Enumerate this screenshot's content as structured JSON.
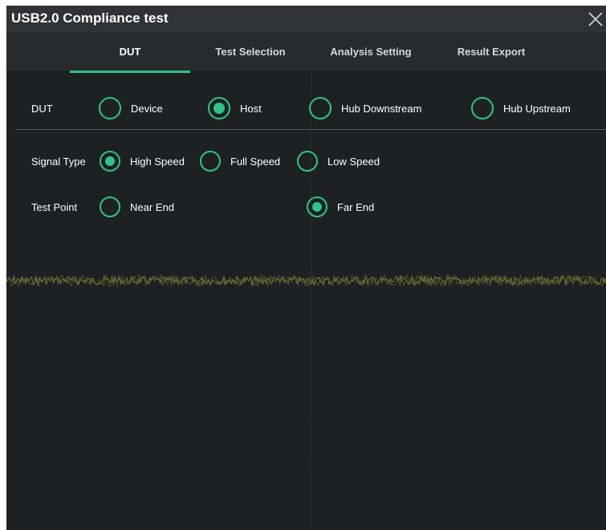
{
  "window": {
    "title": "USB2.0 Compliance test"
  },
  "tabs": [
    {
      "label": "DUT",
      "active": true
    },
    {
      "label": "Test Selection",
      "active": false
    },
    {
      "label": "Analysis Setting",
      "active": false
    },
    {
      "label": "Result Export",
      "active": false
    }
  ],
  "dut": {
    "label": "DUT",
    "options": [
      {
        "label": "Device",
        "selected": false
      },
      {
        "label": "Host",
        "selected": true
      },
      {
        "label": "Hub Downstream",
        "selected": false
      },
      {
        "label": "Hub Upstream",
        "selected": false
      }
    ]
  },
  "signal_type": {
    "label": "Signal Type",
    "options": [
      {
        "label": "High Speed",
        "selected": true
      },
      {
        "label": "Full Speed",
        "selected": false
      },
      {
        "label": "Low Speed",
        "selected": false
      }
    ]
  },
  "test_point": {
    "label": "Test Point",
    "options": [
      {
        "label": "Near End",
        "selected": false
      },
      {
        "label": "Far End",
        "selected": true
      }
    ]
  },
  "colors": {
    "accent": "#2fc487",
    "background": "#1f2326",
    "waveform": "#8a8a3a"
  },
  "icons": {
    "close": "close-icon"
  }
}
